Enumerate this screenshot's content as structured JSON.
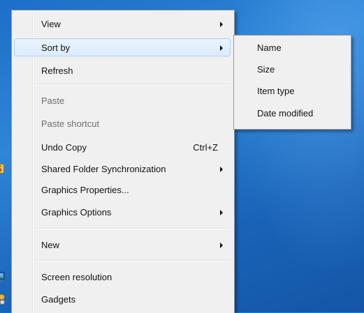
{
  "main_menu": {
    "items": [
      {
        "label": "View"
      },
      {
        "label": "Sort by"
      },
      {
        "label": "Refresh"
      },
      {
        "label": "Paste"
      },
      {
        "label": "Paste shortcut"
      },
      {
        "label": "Undo Copy",
        "shortcut": "Ctrl+Z"
      },
      {
        "label": "Shared Folder Synchronization"
      },
      {
        "label": "Graphics Properties..."
      },
      {
        "label": "Graphics Options"
      },
      {
        "label": "New"
      },
      {
        "label": "Screen resolution"
      },
      {
        "label": "Gadgets"
      }
    ]
  },
  "sort_submenu": {
    "items": [
      {
        "label": "Name"
      },
      {
        "label": "Size"
      },
      {
        "label": "Item type"
      },
      {
        "label": "Date modified"
      }
    ]
  },
  "colors": {
    "highlight": "#dcebfc",
    "highlight_border": "#a8d2f7",
    "disabled_text": "#6d6d6d",
    "desktop": "#1b6fc7"
  }
}
